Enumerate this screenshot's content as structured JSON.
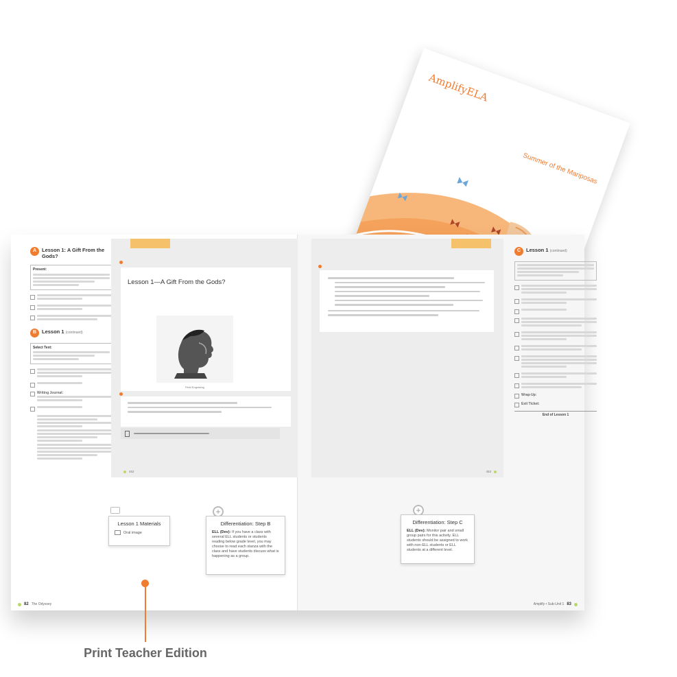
{
  "student_edition": {
    "brand": "AmplifyELA",
    "title": "Summer of the Mariposas"
  },
  "left_sidebar": {
    "lesson_a_badge": "A",
    "lesson_a_title": "Lesson 1: A Gift From the Gods?",
    "present_label": "Present:",
    "lesson_b_badge": "B",
    "lesson_b_title": "Lesson 1",
    "lesson_b_sub": "(continued)",
    "select_text_label": "Select Text:",
    "writing_journal_label": "Writing Journal:"
  },
  "left_inner_page": {
    "heading": "Lesson 1—A Gift From the Gods?",
    "portrait_caption": "Field Engraving",
    "folio_number": "452"
  },
  "right_sidebar": {
    "lesson_c_badge": "C",
    "lesson_c_title": "Lesson 1",
    "lesson_c_sub": "(continued)",
    "wrap_up_label": "Wrap-Up:",
    "exit_ticket_label": "Exit Ticket:",
    "end_label": "End of Lesson 1"
  },
  "right_inner_page": {
    "folio_number": "453"
  },
  "boxes": {
    "materials_title": "Lesson 1 Materials",
    "materials_item": "Oral image",
    "diff_b_title": "Differentiation: Step B",
    "diff_b_lead": "ELL (Dev):",
    "diff_b_text": "If you have a class with several ELL students or students reading below grade level, you may choose to read each stanza with the class and have students discuss what is happening as a group.",
    "diff_c_title": "Differentiation: Step C",
    "diff_c_lead": "ELL (Dev):",
    "diff_c_text": "Monitor pair and small group pairs for this activity. ELL students should be assigned to work with non-ELL students or ELL students at a different level."
  },
  "footer": {
    "left_page_number": "82",
    "left_text": "The Odyssey",
    "right_text": "Amplify • Sub-Unit 1",
    "right_page_number": "83"
  },
  "label": {
    "print_teacher_edition": "Print Teacher Edition"
  },
  "colors": {
    "accent_orange": "#f07c30",
    "tab_yellow": "#f5c26b",
    "leaf_green": "#b9d86a"
  }
}
